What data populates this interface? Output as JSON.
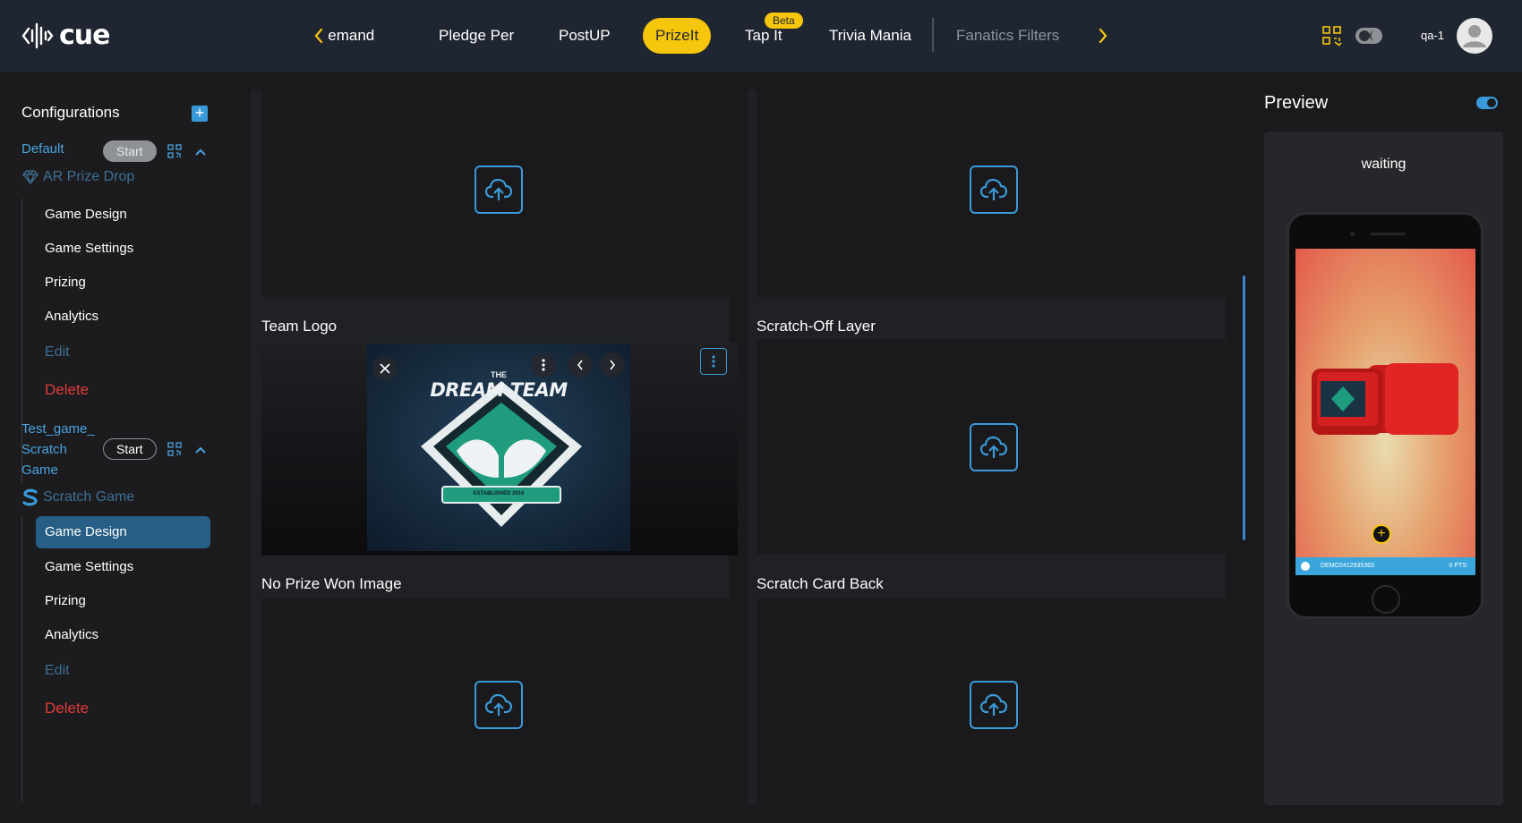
{
  "header": {
    "logo_text": "cue",
    "tabs": [
      {
        "label": "Demand",
        "state": "normal"
      },
      {
        "label": "Pledge Per",
        "state": "normal"
      },
      {
        "label": "PostUP",
        "state": "normal"
      },
      {
        "label": "PrizeIt",
        "state": "active"
      },
      {
        "label": "Tap It",
        "state": "normal"
      },
      {
        "label": "Trivia Mania",
        "state": "normal"
      },
      {
        "label": "Fanatics Filters",
        "state": "muted"
      }
    ],
    "beta_badge": "Beta",
    "user_label": "qa-1"
  },
  "sidebar": {
    "title": "Configurations",
    "configs": [
      {
        "name": "Default",
        "start_label": "Start",
        "game_type": "AR Prize Drop",
        "menu": [
          "Game Design",
          "Game Settings",
          "Prizing",
          "Analytics",
          "Edit",
          "Delete"
        ]
      },
      {
        "name_lines": [
          "Test_game_",
          "Scratch",
          "Game"
        ],
        "start_label": "Start",
        "game_type": "Scratch Game",
        "menu": [
          "Game Design",
          "Game Settings",
          "Prizing",
          "Analytics",
          "Edit",
          "Delete"
        ],
        "active_item": "Game Design"
      }
    ]
  },
  "main": {
    "labels": {
      "team_logo": "Team Logo",
      "scratch_off_layer": "Scratch-Off Layer",
      "no_prize_won_image": "No Prize Won Image",
      "scratch_card_back": "Scratch Card Back"
    },
    "team_logo_image": {
      "top_text": "THE",
      "main_text": "DREAM TEAM",
      "ribbon_text": "ESTABLISHED 2016"
    }
  },
  "preview": {
    "title": "Preview",
    "status": "waiting",
    "phone_bar_id": "DEMO2412935363",
    "phone_bar_points": "0 PTS"
  },
  "colors": {
    "accent_yellow": "#f5c60c",
    "accent_blue": "#3a9ad9",
    "delete_red": "#e03b3b",
    "active_item_bg": "#275e85",
    "header_bg": "#1f2631"
  }
}
